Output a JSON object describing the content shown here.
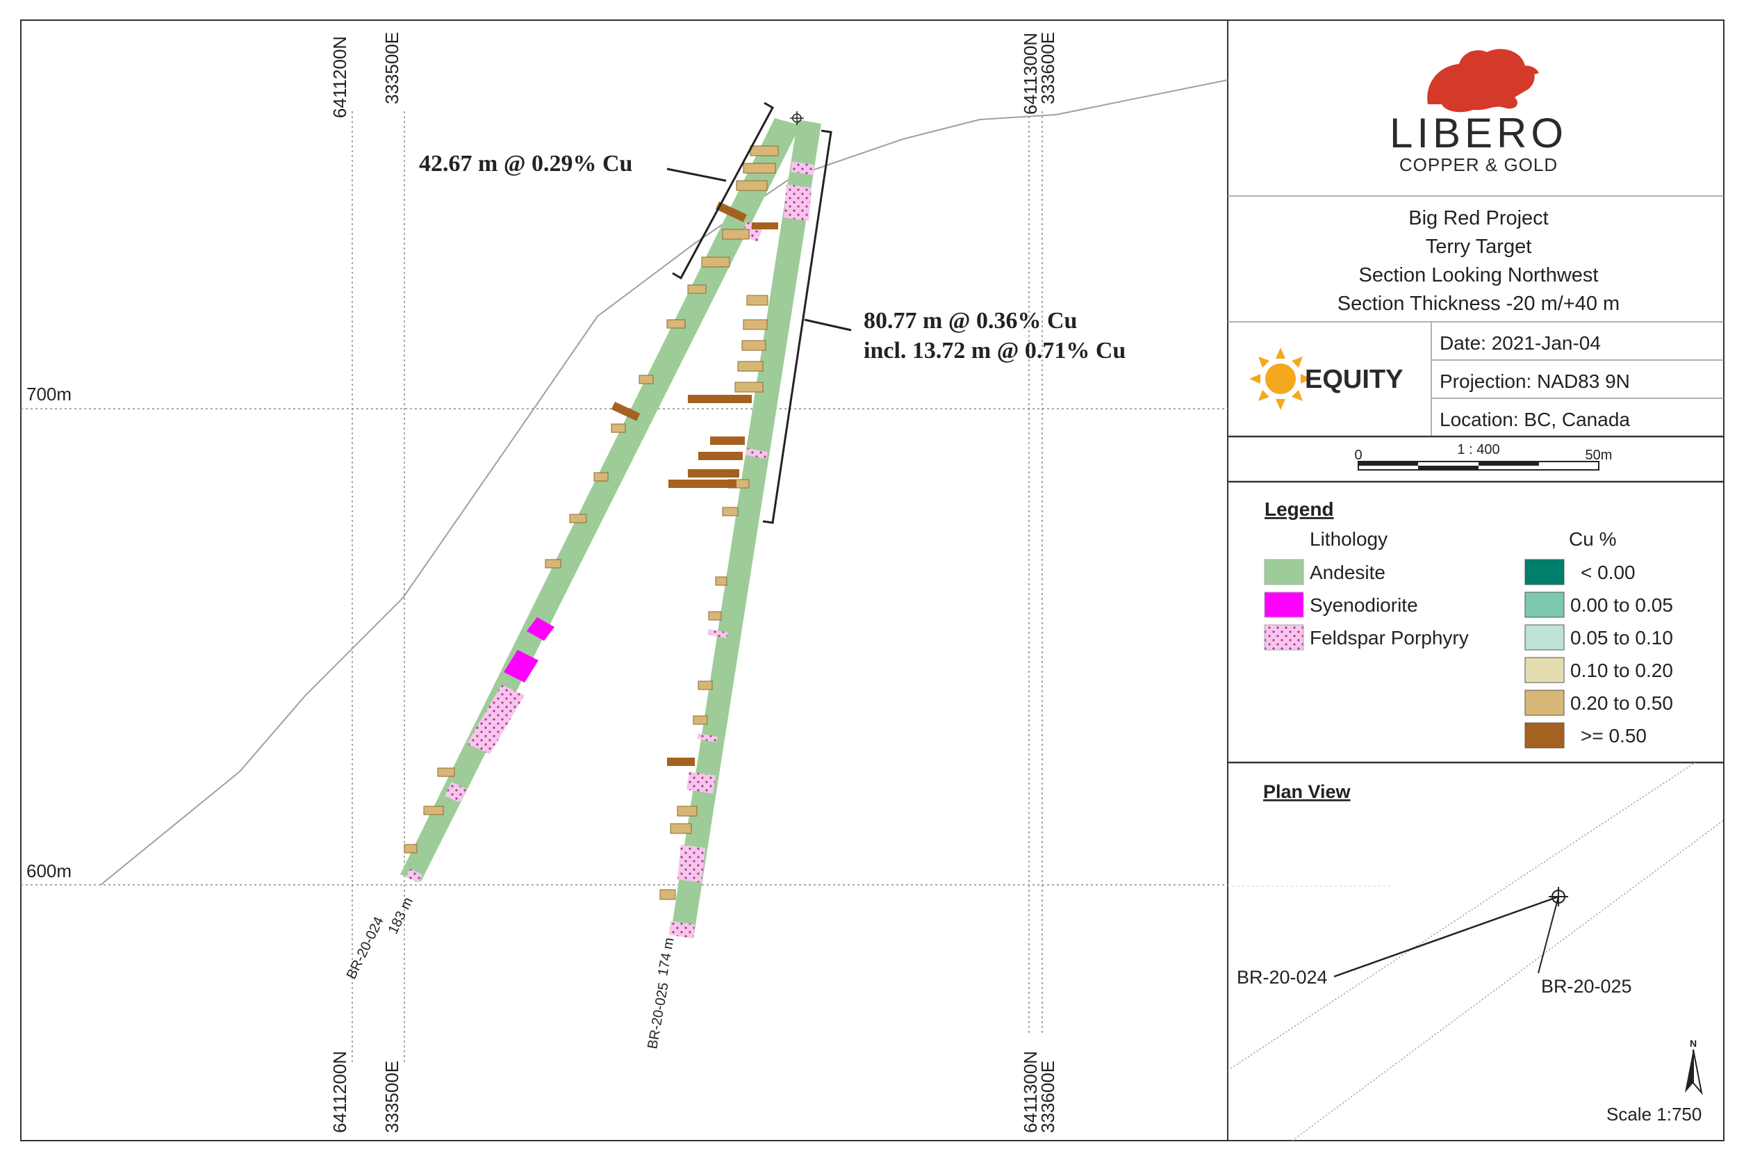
{
  "section": {
    "grid_labels": {
      "n_6411200": "6411200N",
      "e_333500": "333500E",
      "n_6411300": "6411300N",
      "e_333600": "333600E",
      "elev_700": "700m",
      "elev_600": "600m"
    },
    "annotations": {
      "upper_intercept": "42.67 m @ 0.29% Cu",
      "lower_intercept_line1": "80.77 m @ 0.36% Cu",
      "lower_intercept_line2": "incl. 13.72 m @ 0.71% Cu"
    },
    "holes": {
      "br024_label": "BR-20-024",
      "br024_depth": "183 m",
      "br025_label": "BR-20-025",
      "br025_depth": "174 m"
    }
  },
  "branding": {
    "company_name": "LIBERO",
    "company_tagline": "COPPER & GOLD",
    "partner_name": "EQUITY"
  },
  "title_block": {
    "project": "Big Red Project",
    "target": "Terry Target",
    "view": "Section Looking Northwest",
    "thickness": "Section Thickness -20 m/+40 m",
    "date": "Date: 2021-Jan-04",
    "projection": "Projection: NAD83 9N",
    "location": "Location: BC, Canada"
  },
  "scale_bar": {
    "start": "0",
    "ratio": "1 : 400",
    "end": "50m"
  },
  "legend": {
    "heading": "Legend",
    "lithology_heading": "Lithology",
    "lithology": [
      {
        "label": "Andesite",
        "color": "#9dcc98"
      },
      {
        "label": "Syenodiorite",
        "color": "#ff00ff"
      },
      {
        "label": "Feldspar Porphyry",
        "color": "#f6c6ee"
      }
    ],
    "cu_heading": "Cu %",
    "cu_classes": [
      {
        "label": "< 0.00",
        "color": "#007f6c"
      },
      {
        "label": "0.00 to 0.05",
        "color": "#7cc8b0"
      },
      {
        "label": "0.05 to 0.10",
        "color": "#bfe3d4"
      },
      {
        "label": "0.10 to 0.20",
        "color": "#e3ddb0"
      },
      {
        "label": "0.20 to 0.50",
        "color": "#d8b676"
      },
      {
        "label": ">= 0.50",
        "color": "#a5611f"
      }
    ]
  },
  "plan_view": {
    "heading": "Plan View",
    "hole_a": "BR-20-024",
    "hole_b": "BR-20-025",
    "north": "N",
    "scale": "Scale 1:750"
  }
}
